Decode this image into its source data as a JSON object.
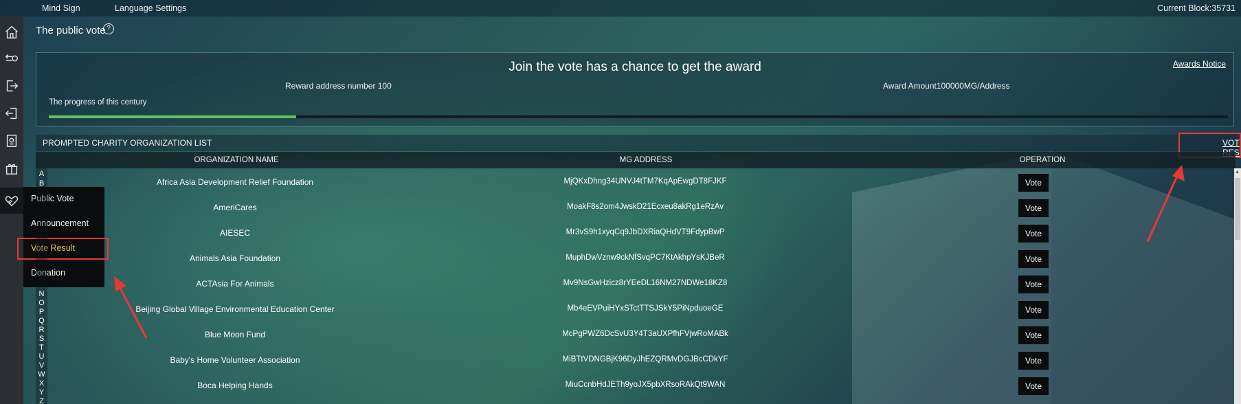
{
  "topbar": {
    "menu": [
      "Mind Sign",
      "Language Settings"
    ],
    "current_block": "Current Block:35731"
  },
  "rail": {
    "icons": [
      "home-icon",
      "transfer-icon",
      "logout-icon",
      "login-icon",
      "contract-icon",
      "gift-icon",
      "heart-hands-icon"
    ]
  },
  "submenu": {
    "items": [
      "Public Vote",
      "Announcement",
      "Vote Result",
      "Donation"
    ],
    "highlighted": "Vote Result"
  },
  "page": {
    "title": "The public vote",
    "help": "?"
  },
  "award": {
    "title": "Join the vote has a chance to get the award",
    "notice_link": "Awards Notice",
    "reward_address": "Reward address number 100",
    "award_amount": "Award Amount100000MG/Address",
    "progress_label": "The progress of this century",
    "progress_fraction": 0.21
  },
  "list": {
    "title": "PROMPTED CHARITY ORGANIZATION LIST",
    "vote_result_link": "VOTE RESULT",
    "columns": [
      "ORGANIZATION NAME",
      "MG ADDRESS",
      "OPERATION"
    ],
    "alphabet": [
      "A",
      "B",
      "N",
      "O",
      "P",
      "Q",
      "R",
      "S",
      "T",
      "U",
      "V",
      "W",
      "X",
      "Y",
      "Z"
    ],
    "rows": [
      {
        "org": "Africa Asia Development Relief Foundation",
        "address": "MjQKxDhng34UNVJ4tTM7KqApEwgDT8FJKF",
        "action": "Vote"
      },
      {
        "org": "AmeriCares",
        "address": "MoakF8s2om4JwskD21Ecxeu8akRg1eRzAv",
        "action": "Vote"
      },
      {
        "org": "AIESEC",
        "address": "Mr3vS9h1xyqCq9JbDXRiaQHdVT9FdypBwP",
        "action": "Vote"
      },
      {
        "org": "Animals Asia Foundation",
        "address": "MuphDwVznw9ckNfSvqPC7KtAkhpYsKJBeR",
        "action": "Vote"
      },
      {
        "org": "ACTAsia For Animals",
        "address": "Mv9NsGwHzicz8rYEeDL16NM27NDWe18KZ8",
        "action": "Vote"
      },
      {
        "org": "Beijing Global Village Environmental Education Center",
        "address": "Mb4eEVPuiHYxSTctTTSJSkY5PiNpduoeGE",
        "action": "Vote"
      },
      {
        "org": "Blue Moon Fund",
        "address": "McPgPWZ6DcSvU3Y4T3aUXPfhFVjwRoMABk",
        "action": "Vote"
      },
      {
        "org": "Baby's Home Volunteer Association",
        "address": "MiBTtVDNGBjK96DyJhEZQRMvDGJBcCDkYF",
        "action": "Vote"
      },
      {
        "org": "Boca Helping Hands",
        "address": "MiuCcnbHdJETh9yoJX5pbXRsoRAkQt9WAN",
        "action": "Vote"
      }
    ]
  }
}
